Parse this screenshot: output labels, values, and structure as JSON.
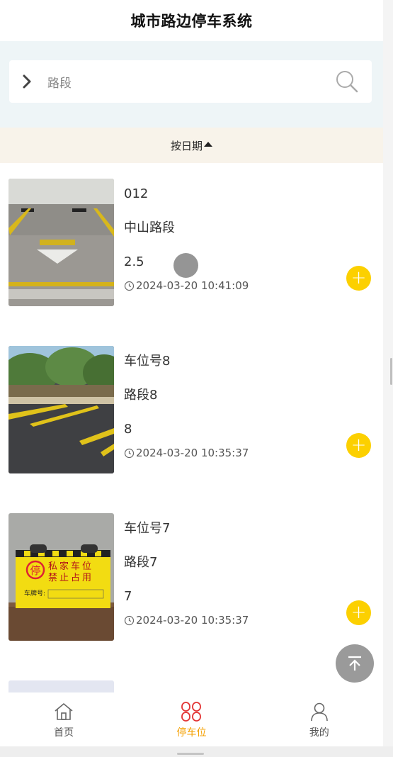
{
  "header": {
    "title": "城市路边停车系统"
  },
  "search": {
    "placeholder": "路段"
  },
  "sort": {
    "label": "按日期"
  },
  "items": [
    {
      "spot": "012",
      "road": "中山路段",
      "price": "2.5",
      "time": "2024-03-20 10:41:09"
    },
    {
      "spot": "车位号8",
      "road": "路段8",
      "price": "8",
      "time": "2024-03-20 10:35:37"
    },
    {
      "spot": "车位号7",
      "road": "路段7",
      "price": "7",
      "time": "2024-03-20 10:35:37"
    }
  ],
  "sign": {
    "line1": "私家车位",
    "line2": "禁止占用",
    "plate_label": "车牌号:",
    "badge": "停"
  },
  "tabs": [
    {
      "label": "首页",
      "icon": "home-icon"
    },
    {
      "label": "停车位",
      "icon": "parking-grid-icon"
    },
    {
      "label": "我的",
      "icon": "user-icon"
    }
  ],
  "colors": {
    "accent": "#f4a000",
    "add_button": "#fcd000",
    "search_band": "#eef5f7",
    "sort_bar": "#f8f3ea"
  }
}
